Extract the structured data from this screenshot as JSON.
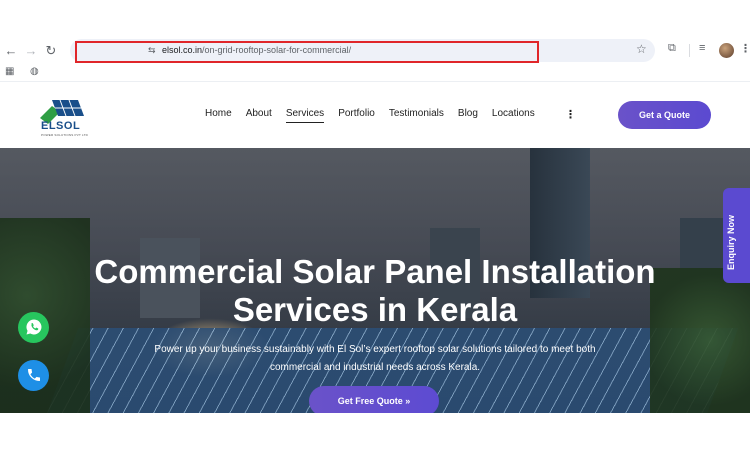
{
  "browser": {
    "url_domain": "elsol.co.in",
    "url_path": "/on-grid-rooftop-solar-for-commercial/",
    "back_icon": "arrow-left-icon",
    "forward_icon": "arrow-right-icon",
    "reload_icon": "reload-icon",
    "highlight_color": "#e0262a"
  },
  "site": {
    "logo_text": "ELSOL",
    "logo_sub": "POWER SOLUTIONS PVT LTD",
    "nav": [
      {
        "label": "Home"
      },
      {
        "label": "About"
      },
      {
        "label": "Services",
        "active": true
      },
      {
        "label": "Portfolio"
      },
      {
        "label": "Testimonials"
      },
      {
        "label": "Blog"
      },
      {
        "label": "Locations"
      }
    ],
    "quote_label": "Get a Quote",
    "accent_color": "#5b4ad0"
  },
  "hero": {
    "title_line1": "Commercial Solar Panel Installation",
    "title_line2": "Services in Kerala",
    "subtitle_line1": "Power up your business sustainably with El Sol’s expert rooftop solar solutions tailored to meet both",
    "subtitle_line2": "commercial and industrial needs across Kerala.",
    "cta_label": "Get Free Quote »",
    "enquiry_label": "Enquiry Now"
  },
  "floating": {
    "whatsapp_color": "#27c65e",
    "phone_color": "#1e8fe6"
  }
}
